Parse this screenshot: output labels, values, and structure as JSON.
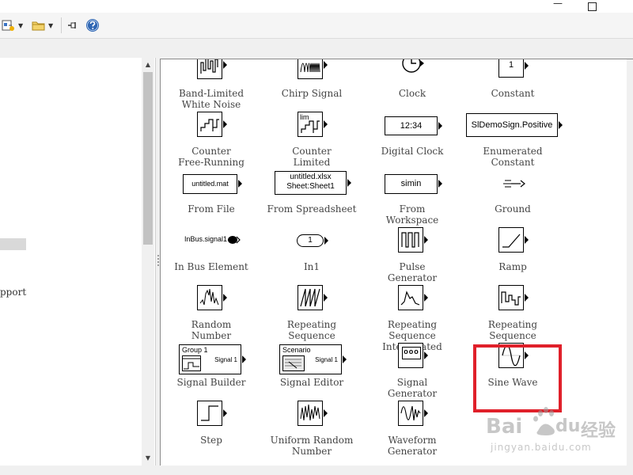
{
  "window": {
    "minimize_icon": "minimize-icon",
    "maximize_icon": "maximize-icon"
  },
  "toolbar": {
    "icons": [
      "new-model-icon",
      "open-folder-icon",
      "pin-icon",
      "help-icon"
    ]
  },
  "left_panel": {
    "partial_text": "pport"
  },
  "blocks": [
    {
      "id": "band-limited-white-noise",
      "label": "Band-Limited\nWhite Noise"
    },
    {
      "id": "chirp-signal",
      "label": "Chirp Signal"
    },
    {
      "id": "clock",
      "label": "Clock"
    },
    {
      "id": "constant",
      "label": "Constant",
      "text": "1"
    },
    {
      "id": "counter-free-running",
      "label": "Counter\nFree-Running"
    },
    {
      "id": "counter-limited",
      "label": "Counter\nLimited",
      "text": "lim"
    },
    {
      "id": "digital-clock",
      "label": "Digital Clock",
      "text": "12:34"
    },
    {
      "id": "enumerated-constant",
      "label": "Enumerated\nConstant",
      "text": "SlDemoSign.Positive"
    },
    {
      "id": "from-file",
      "label": "From File",
      "text": "untitled.mat"
    },
    {
      "id": "from-spreadsheet",
      "label": "From Spreadsheet",
      "text": "untitled.xlsx",
      "text2": "Sheet:Sheet1"
    },
    {
      "id": "from-workspace",
      "label": "From\nWorkspace",
      "text": "simin"
    },
    {
      "id": "ground",
      "label": "Ground"
    },
    {
      "id": "in-bus-element",
      "label": "In Bus Element",
      "text": "InBus.signal1"
    },
    {
      "id": "in1",
      "label": "In1",
      "text": "1"
    },
    {
      "id": "pulse-generator",
      "label": "Pulse\nGenerator"
    },
    {
      "id": "ramp",
      "label": "Ramp"
    },
    {
      "id": "random-number",
      "label": "Random\nNumber"
    },
    {
      "id": "repeating-sequence",
      "label": "Repeating\nSequence"
    },
    {
      "id": "repeating-sequence-interpolated",
      "label": "Repeating\nSequence\nInterpolated"
    },
    {
      "id": "repeating-sequence-stair",
      "label": "Repeating\nSequence\nStair"
    },
    {
      "id": "signal-builder",
      "label": "Signal Builder",
      "text": "Group 1",
      "text2": "Signal 1"
    },
    {
      "id": "signal-editor",
      "label": "Signal Editor",
      "text": "Scenario",
      "text2": "Signal 1"
    },
    {
      "id": "signal-generator",
      "label": "Signal\nGenerator",
      "text": "ooo"
    },
    {
      "id": "sine-wave",
      "label": "Sine Wave"
    },
    {
      "id": "step",
      "label": "Step"
    },
    {
      "id": "uniform-random-number",
      "label": "Uniform Random\nNumber"
    },
    {
      "id": "waveform-generator",
      "label": "Waveform\nGenerator"
    }
  ],
  "highlight": {
    "block": "sine-wave",
    "color": "#e0202a"
  },
  "watermark": {
    "brand": "Bai",
    "brand2": "du",
    "cn": "经验",
    "url": "jingyan.baidu.com"
  },
  "colors": {
    "panel_bg": "#ffffff",
    "chrome_bg": "#f0f0f0",
    "highlight": "#e0202a"
  }
}
